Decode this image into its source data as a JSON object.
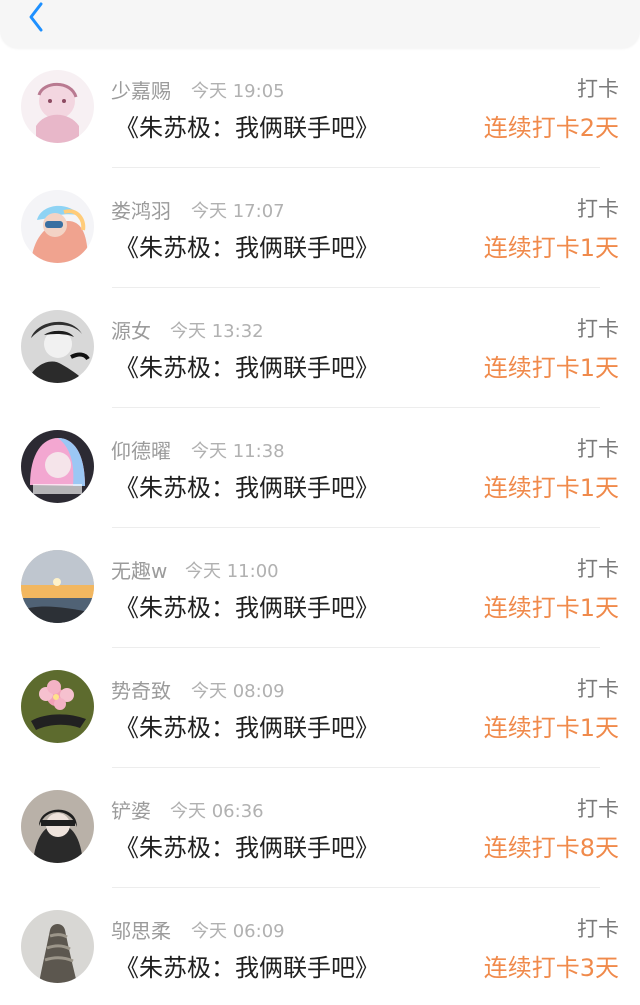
{
  "header": {
    "back_icon": "chevron-left-icon",
    "accent": "#1e90ff"
  },
  "colors": {
    "name": "#9b9b9b",
    "time": "#b1b1b1",
    "title": "#202020",
    "streak": "#f08a4b",
    "action": "#7a7a7a"
  },
  "items": [
    {
      "name": "少嘉赐",
      "time": "今天 19:05",
      "title": "《朱苏极：我俩联手吧》",
      "action": "打卡",
      "streak": "连续打卡2天",
      "avatar_icon": "avatar-illustration-icon"
    },
    {
      "name": "娄鸿羽",
      "time": "今天 17:07",
      "title": "《朱苏极：我俩联手吧》",
      "action": "打卡",
      "streak": "连续打卡1天",
      "avatar_icon": "avatar-colorful-hair-icon"
    },
    {
      "name": "源女",
      "time": "今天 13:32",
      "title": "《朱苏极：我俩联手吧》",
      "action": "打卡",
      "streak": "连续打卡1天",
      "avatar_icon": "avatar-black-white-photo-icon"
    },
    {
      "name": "仰德曜",
      "time": "今天 11:38",
      "title": "《朱苏极：我俩联手吧》",
      "action": "打卡",
      "streak": "连续打卡1天",
      "avatar_icon": "avatar-pastel-hair-icon"
    },
    {
      "name": "无趣w",
      "time": "今天 11:00",
      "title": "《朱苏极：我俩联手吧》",
      "action": "打卡",
      "streak": "连续打卡1天",
      "avatar_icon": "avatar-sunset-sea-icon"
    },
    {
      "name": "势奇致",
      "time": "今天 08:09",
      "title": "《朱苏极：我俩联手吧》",
      "action": "打卡",
      "streak": "连续打卡1天",
      "avatar_icon": "avatar-flower-hairpin-icon"
    },
    {
      "name": "铲婆",
      "time": "今天 06:36",
      "title": "《朱苏极：我俩联手吧》",
      "action": "打卡",
      "streak": "连续打卡8天",
      "avatar_icon": "avatar-portrait-icon"
    },
    {
      "name": "邬思柔",
      "time": "今天 06:09",
      "title": "《朱苏极：我俩联手吧》",
      "action": "打卡",
      "streak": "连续打卡3天",
      "avatar_icon": "avatar-sculpture-icon"
    }
  ]
}
